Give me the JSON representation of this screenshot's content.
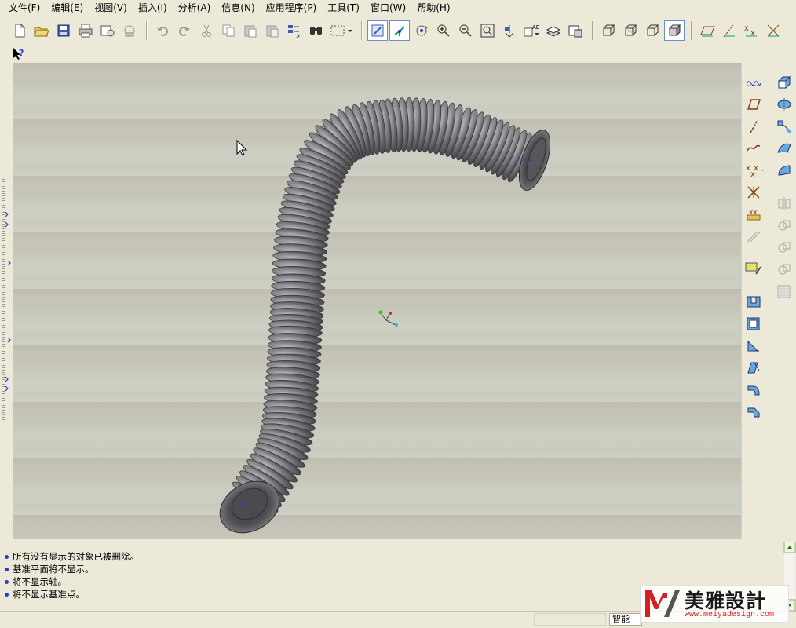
{
  "menubar": {
    "items": [
      "文件(F)",
      "编辑(E)",
      "视图(V)",
      "插入(I)",
      "分析(A)",
      "信息(N)",
      "应用程序(P)",
      "工具(T)",
      "窗口(W)",
      "帮助(H)"
    ]
  },
  "toolbar": {
    "file_group": [
      "new-file-icon",
      "open-folder-icon",
      "save-icon",
      "print-icon",
      "send-mail-icon",
      "erase-icon"
    ],
    "edit_group": [
      "undo-icon",
      "redo-icon",
      "cut-icon",
      "copy-icon",
      "paste-icon",
      "paste-special-icon",
      "regenerate-icon",
      "find-icon",
      "selection-box-icon"
    ],
    "view_group": [
      "repaint-icon",
      "spin-center-icon",
      "orient-icon",
      "zoom-in-icon",
      "zoom-out-icon",
      "refit-icon",
      "reorient-icon",
      "saved-views-icon",
      "layers-icon",
      "view-manager-icon"
    ],
    "display_group": [
      "wireframe-icon",
      "hidden-line-icon",
      "no-hidden-icon",
      "shading-icon"
    ],
    "datum_group": [
      "datum-planes-icon",
      "datum-axes-icon",
      "datum-points-icon",
      "coord-sys-icon"
    ],
    "context_help": "context-help-icon"
  },
  "right_panel": {
    "left_col": [
      "datum-curve-icon",
      "datum-plane-icon",
      "datum-axis-icon",
      "sketched-curve-icon",
      "datum-point-icon",
      "coord-system-icon",
      "analysis-feature-icon",
      "blend-icon",
      "sketch-tool-icon",
      "hole-icon",
      "shell-icon",
      "rib-icon",
      "draft-icon",
      "round-icon",
      "chamfer-icon"
    ],
    "right_col": [
      "extrude-icon",
      "revolve-icon",
      "sweep-icon",
      "swept-blend-icon",
      "boundary-blend-icon",
      "mirror-icon",
      "merge-icon",
      "trim-icon",
      "intersect-icon",
      "pattern-icon"
    ]
  },
  "messages": [
    "所有没有显示的对象已被删除。",
    "基准平面将不显示。",
    "将不显示轴。",
    "将不显示基准点。"
  ],
  "status": {
    "filter": "智能"
  },
  "watermark": {
    "brand": "美雅設計",
    "url": "www.meiyadesign.com"
  },
  "colors": {
    "accent": "#1f3ccf",
    "viewport_bg": "#c8c8bc",
    "hose": "#6e6e72"
  }
}
